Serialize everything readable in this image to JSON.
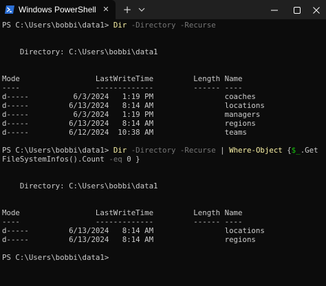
{
  "window": {
    "tab_title": "Windows PowerShell",
    "tab_close_glyph": "✕",
    "new_tab_glyph": "+",
    "colors": {
      "titlebar": "#202020",
      "terminal_bg": "#0c0c0c",
      "text": "#cccccc",
      "command": "#f9f1a5",
      "parameter": "#767676",
      "variable": "#16c60c",
      "icon_blue": "#2b6fd6"
    },
    "icons": {
      "tab": "powershell-icon",
      "dropdown": "chevron-down-icon",
      "minimize": "minimize-icon",
      "maximize": "maximize-icon",
      "close": "close-icon"
    }
  },
  "terminal": {
    "lines": [
      {
        "segments": [
          {
            "t": "PS C:\\Users\\bobbi\\data1> ",
            "c": "plain"
          },
          {
            "t": "Dir",
            "c": "cmd"
          },
          {
            "t": " -Directory -Recurse",
            "c": "param"
          }
        ]
      },
      {
        "segments": []
      },
      {
        "segments": []
      },
      {
        "segments": [
          {
            "t": "    Directory: C:\\Users\\bobbi\\data1",
            "c": "plain"
          }
        ]
      },
      {
        "segments": []
      },
      {
        "segments": []
      },
      {
        "segments": [
          {
            "t": "Mode                 LastWriteTime         Length Name",
            "c": "plain"
          }
        ]
      },
      {
        "segments": [
          {
            "t": "----                 -------------         ------ ----",
            "c": "plain"
          }
        ]
      },
      {
        "segments": [
          {
            "t": "d-----          6/3/2024   1:19 PM                coaches",
            "c": "plain"
          }
        ]
      },
      {
        "segments": [
          {
            "t": "d-----         6/13/2024   8:14 AM                locations",
            "c": "plain"
          }
        ]
      },
      {
        "segments": [
          {
            "t": "d-----          6/3/2024   1:19 PM                managers",
            "c": "plain"
          }
        ]
      },
      {
        "segments": [
          {
            "t": "d-----         6/13/2024   8:14 AM                regions",
            "c": "plain"
          }
        ]
      },
      {
        "segments": [
          {
            "t": "d-----         6/12/2024  10:38 AM                teams",
            "c": "plain"
          }
        ]
      },
      {
        "segments": []
      },
      {
        "segments": [
          {
            "t": "PS C:\\Users\\bobbi\\data1> ",
            "c": "plain"
          },
          {
            "t": "Dir",
            "c": "cmd"
          },
          {
            "t": " -Directory -Recurse ",
            "c": "param"
          },
          {
            "t": "| ",
            "c": "pipe"
          },
          {
            "t": "Where-Object",
            "c": "cmd"
          },
          {
            "t": " {",
            "c": "plain"
          },
          {
            "t": "$_",
            "c": "var"
          },
          {
            "t": ".Get",
            "c": "plain"
          }
        ]
      },
      {
        "segments": [
          {
            "t": "FileSystemInfos().Count ",
            "c": "plain"
          },
          {
            "t": "-eq",
            "c": "param"
          },
          {
            "t": " 0 }",
            "c": "num"
          }
        ]
      },
      {
        "segments": []
      },
      {
        "segments": []
      },
      {
        "segments": [
          {
            "t": "    Directory: C:\\Users\\bobbi\\data1",
            "c": "plain"
          }
        ]
      },
      {
        "segments": []
      },
      {
        "segments": []
      },
      {
        "segments": [
          {
            "t": "Mode                 LastWriteTime         Length Name",
            "c": "plain"
          }
        ]
      },
      {
        "segments": [
          {
            "t": "----                 -------------         ------ ----",
            "c": "plain"
          }
        ]
      },
      {
        "segments": [
          {
            "t": "d-----         6/13/2024   8:14 AM                locations",
            "c": "plain"
          }
        ]
      },
      {
        "segments": [
          {
            "t": "d-----         6/13/2024   8:14 AM                regions",
            "c": "plain"
          }
        ]
      },
      {
        "segments": []
      },
      {
        "segments": [
          {
            "t": "PS C:\\Users\\bobbi\\data1>",
            "c": "plain"
          }
        ]
      }
    ]
  }
}
